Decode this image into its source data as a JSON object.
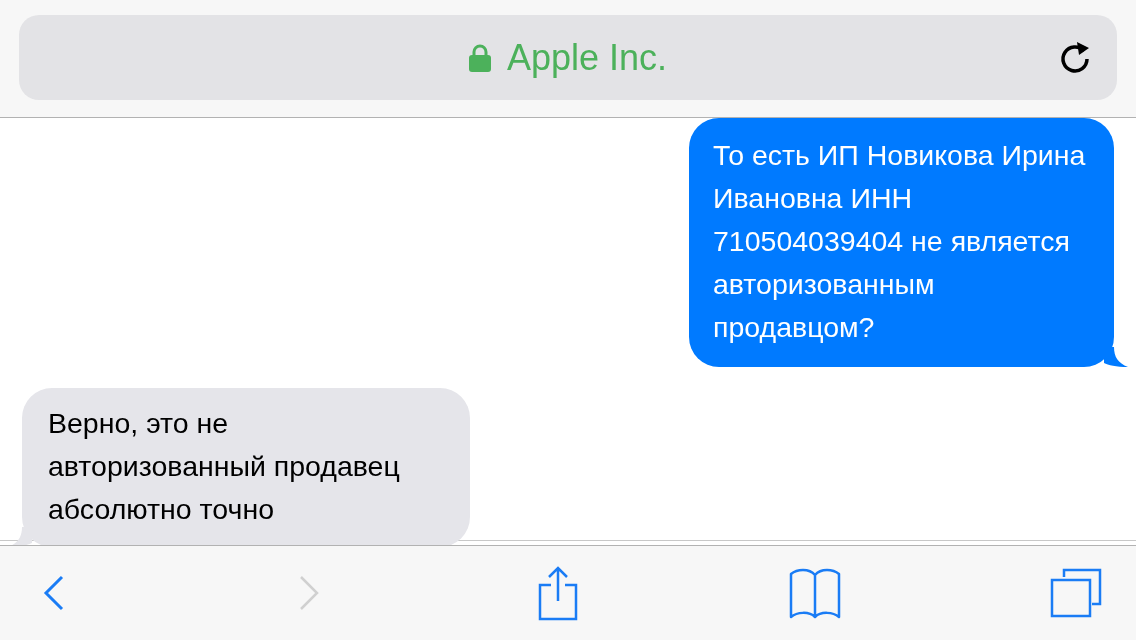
{
  "address_bar": {
    "secure": true,
    "title": "Apple Inc."
  },
  "messages": [
    {
      "kind": "outgoing",
      "text": "То есть ИП Новикова Ирина Ивановна ИНН 710504039404 не является авторизованным продавцом?"
    },
    {
      "kind": "incoming",
      "text": "Верно, это не авторизованный продавец абсолютно точно"
    }
  ],
  "toolbar": [
    {
      "kind": "back",
      "disabled": false
    },
    {
      "kind": "forward",
      "disabled": true
    },
    {
      "kind": "share",
      "disabled": false
    },
    {
      "kind": "bookmarks",
      "disabled": false
    },
    {
      "kind": "tabs",
      "disabled": false
    }
  ]
}
